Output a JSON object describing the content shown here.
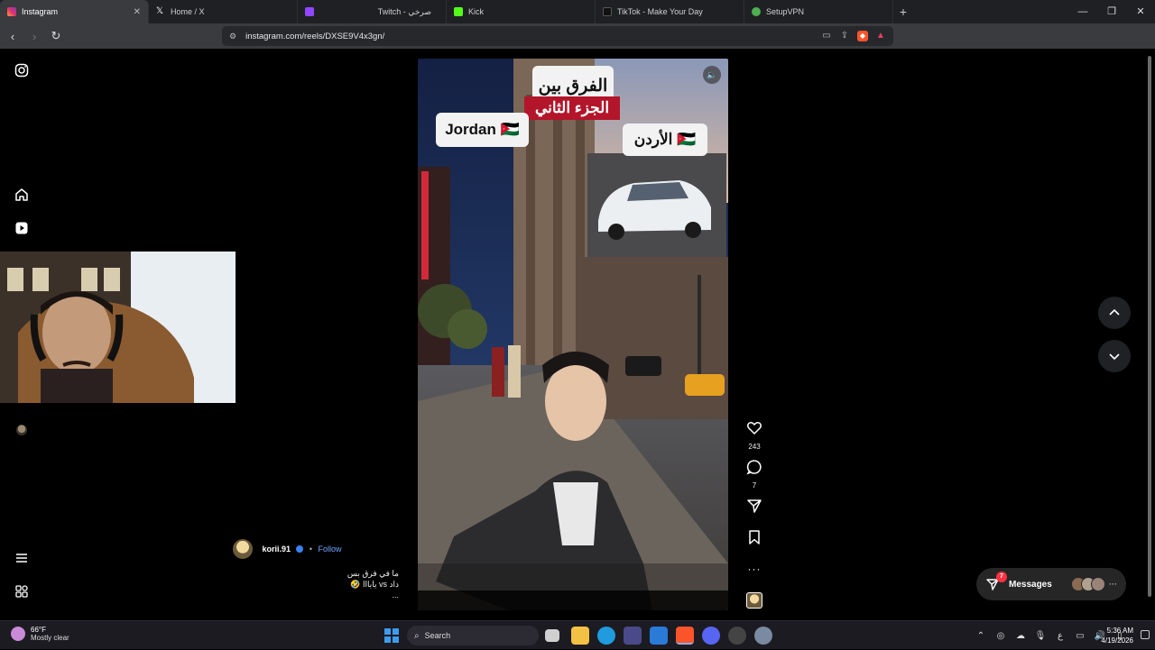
{
  "browser": {
    "tabs": [
      {
        "label": "Instagram",
        "active": true,
        "favicon_color": "#e1306c"
      },
      {
        "label": "Home / X",
        "active": false,
        "favicon_color": "#ffffff"
      },
      {
        "label": "Twitch - صرخي",
        "active": false,
        "favicon_color": "#9146ff"
      },
      {
        "label": "Kick",
        "active": false,
        "favicon_color": "#53fc18"
      },
      {
        "label": "TikTok - Make Your Day",
        "active": false,
        "favicon_color": "#ffffff"
      },
      {
        "label": "SetupVPN",
        "active": false,
        "favicon_color": "#4caf50"
      }
    ],
    "url": "instagram.com/reels/DXSE9V4x3gn/"
  },
  "reel": {
    "overlay_top": "الفرق بين",
    "overlay_part": "الجزء الثاني",
    "overlay_left": "Jordan 🇯🇴",
    "overlay_right": "الأردن 🇯🇴",
    "likes": "243",
    "comments": "7"
  },
  "post": {
    "username": "korii.91",
    "follow": "Follow",
    "separator": "•",
    "caption_line1": "ما في فرق بس",
    "caption_line2": "داد vs يابااا 🤣",
    "caption_more": "..."
  },
  "messages": {
    "label": "Messages",
    "badge": "7"
  },
  "taskbar": {
    "temp": "66°F",
    "weather": "Mostly clear",
    "search_placeholder": "Search",
    "time": "5:36 AM",
    "date": "4/19/2026",
    "lang": "ع"
  },
  "colors": {
    "accent_link": "#6fa6ff",
    "badge_red": "#ff3040",
    "part_label_red": "#b3152a"
  }
}
